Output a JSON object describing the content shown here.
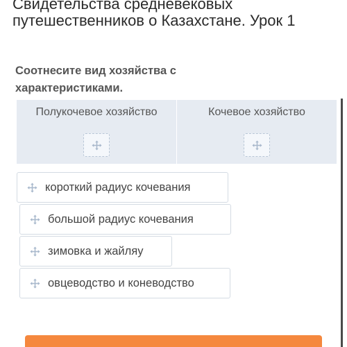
{
  "lesson": {
    "title": "Свидетельства средневековых путешественников о Казахстане. Урок 1"
  },
  "task": {
    "title": "Соотнесите вид хозяйства с характеристиками."
  },
  "columns": [
    {
      "header": "Полукочевое хозяйство",
      "slot_icon": "move-icon"
    },
    {
      "header": "Кочевое хозяйство",
      "slot_icon": "move-icon"
    }
  ],
  "cards": [
    {
      "label": "короткий радиус кочевания",
      "icon": "move-icon"
    },
    {
      "label": "большой радиус кочевания",
      "icon": "move-icon"
    },
    {
      "label": "зимовка и жайляу",
      "icon": "move-icon"
    },
    {
      "label": "овцеводство и коневодство",
      "icon": "move-icon"
    }
  ],
  "colors": {
    "accent": "#f5883e",
    "drop_area": "#e6ebf2",
    "icon": "#a8b8cc"
  }
}
